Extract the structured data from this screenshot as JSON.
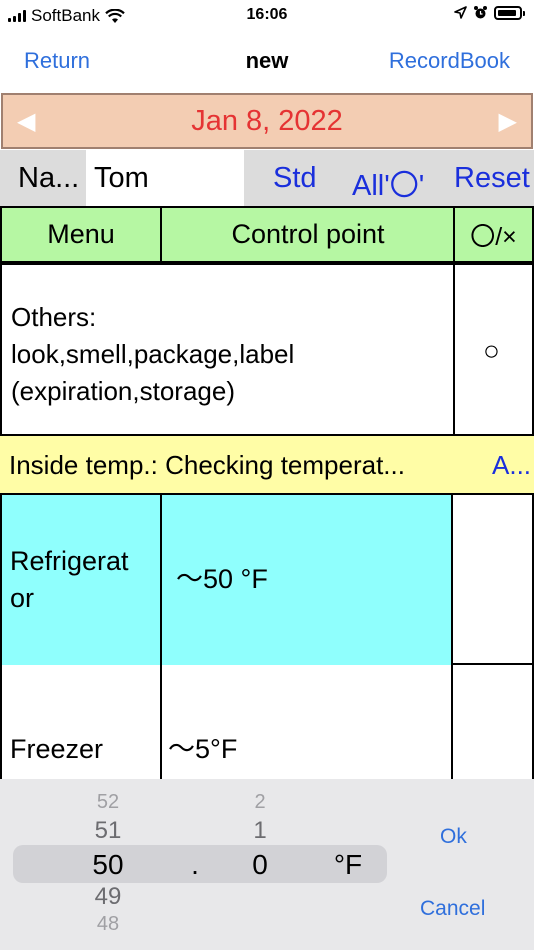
{
  "status_bar": {
    "carrier": "SoftBank",
    "time": "16:06"
  },
  "nav": {
    "back_label": "Return",
    "title": "new",
    "record_label": "RecordBook"
  },
  "date_bar": {
    "date": "Jan 8, 2022",
    "prev_glyph": "◀",
    "next_glyph": "▶"
  },
  "name_row": {
    "label": "Na...",
    "value": "Tom",
    "std_label": "Std",
    "all_label": "All'〇'",
    "reset_label": "Reset"
  },
  "table_header": {
    "menu": "Menu",
    "control_point": "Control point",
    "mark": "〇/×"
  },
  "rows": {
    "others": {
      "lines": [
        "Others:",
        "look,smell,package,label",
        "(expiration,storage)"
      ],
      "mark": "○"
    },
    "section": {
      "text": "Inside temp.: Checking temperat...",
      "link": "A..."
    },
    "refrigerator": {
      "menu_lines": [
        "Refrigerat",
        "or"
      ],
      "control_point": "～50 °F"
    },
    "freezer": {
      "menu": "Freezer",
      "control_point": "～5°F"
    }
  },
  "picker": {
    "int_values": [
      "52",
      "51",
      "50",
      "49",
      "48"
    ],
    "separator": ".",
    "dec_values": [
      "2",
      "1",
      "0"
    ],
    "unit": "°F",
    "ok_label": "Ok",
    "cancel_label": "Cancel"
  },
  "colors": {
    "accent": "#2f6fdc",
    "date_bg": "#f3cdb3",
    "date_text": "#e53333",
    "header_bg": "#b6f7a3",
    "section_bg": "#fffda6",
    "cyan_bg": "#8ffffd"
  }
}
